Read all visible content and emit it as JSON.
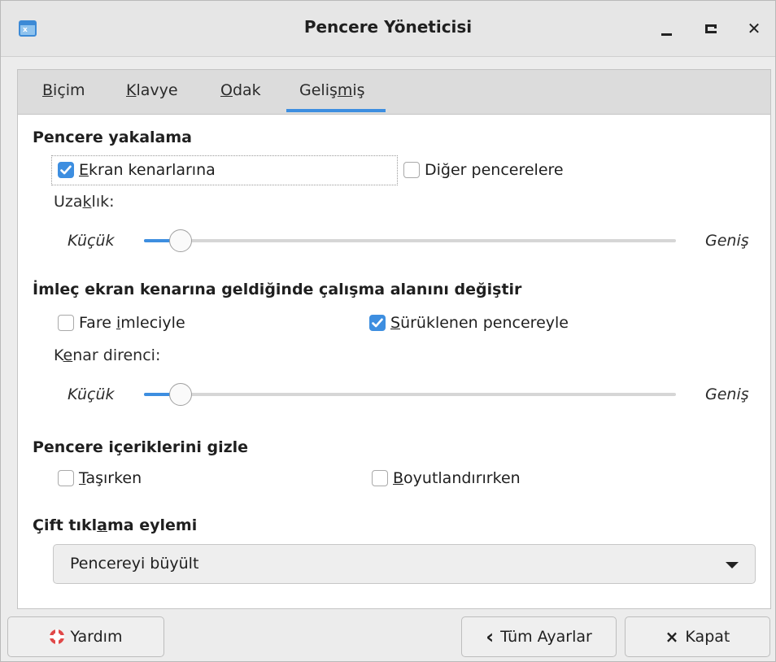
{
  "window": {
    "title": "Pencere Yöneticisi"
  },
  "tabs": [
    {
      "pre": "",
      "key": "B",
      "post": "içim"
    },
    {
      "pre": "",
      "key": "K",
      "post": "lavye"
    },
    {
      "pre": "",
      "key": "O",
      "post": "dak"
    },
    {
      "pre": "Geliş",
      "key": "m",
      "post": "iş"
    }
  ],
  "active_tab": "Gelişmiş",
  "snapping": {
    "title": "Pencere yakalama",
    "screen_edges": {
      "key": "E",
      "rest": "kran kenarlarına",
      "checked": true
    },
    "other_windows": {
      "pre": "Di",
      "key": "ğ",
      "post": "er pencerelere",
      "checked": false
    },
    "distance_label": {
      "pre": "Uza",
      "key": "k",
      "post": "lık:"
    },
    "min_label": "Küçük",
    "max_label": "Geniş",
    "value": 0.05
  },
  "workspace_wrap": {
    "title": "İmleç ekran kenarına geldiğinde çalışma alanını değiştir",
    "mouse_pointer": {
      "pre": "Fare ",
      "key": "i",
      "post": "mleciyle",
      "checked": false
    },
    "dragged_window": {
      "key": "S",
      "rest": "ürüklenen pencereyle",
      "checked": true
    },
    "resistance_label": {
      "pre": "K",
      "key": "e",
      "post": "nar direnci:"
    },
    "min_label": "Küçük",
    "max_label": "Geniş",
    "value": 0.05
  },
  "hide_content": {
    "title": "Pencere içeriklerini gizle",
    "moving": {
      "key": "T",
      "rest": "aşırken",
      "checked": false
    },
    "resizing": {
      "key": "B",
      "rest": "oyutlandırırken",
      "checked": false
    }
  },
  "double_click": {
    "title_pre": "Çift tıkl",
    "title_key": "a",
    "title_post": "ma eylemi",
    "selected": "Pencereyi büyült"
  },
  "buttons": {
    "help": "Yardım",
    "all_settings": "Tüm Ayarlar",
    "close": "Kapat",
    "all_settings_glyph": "‹",
    "close_glyph": "×"
  },
  "colors": {
    "accent": "#3d8ee0"
  }
}
